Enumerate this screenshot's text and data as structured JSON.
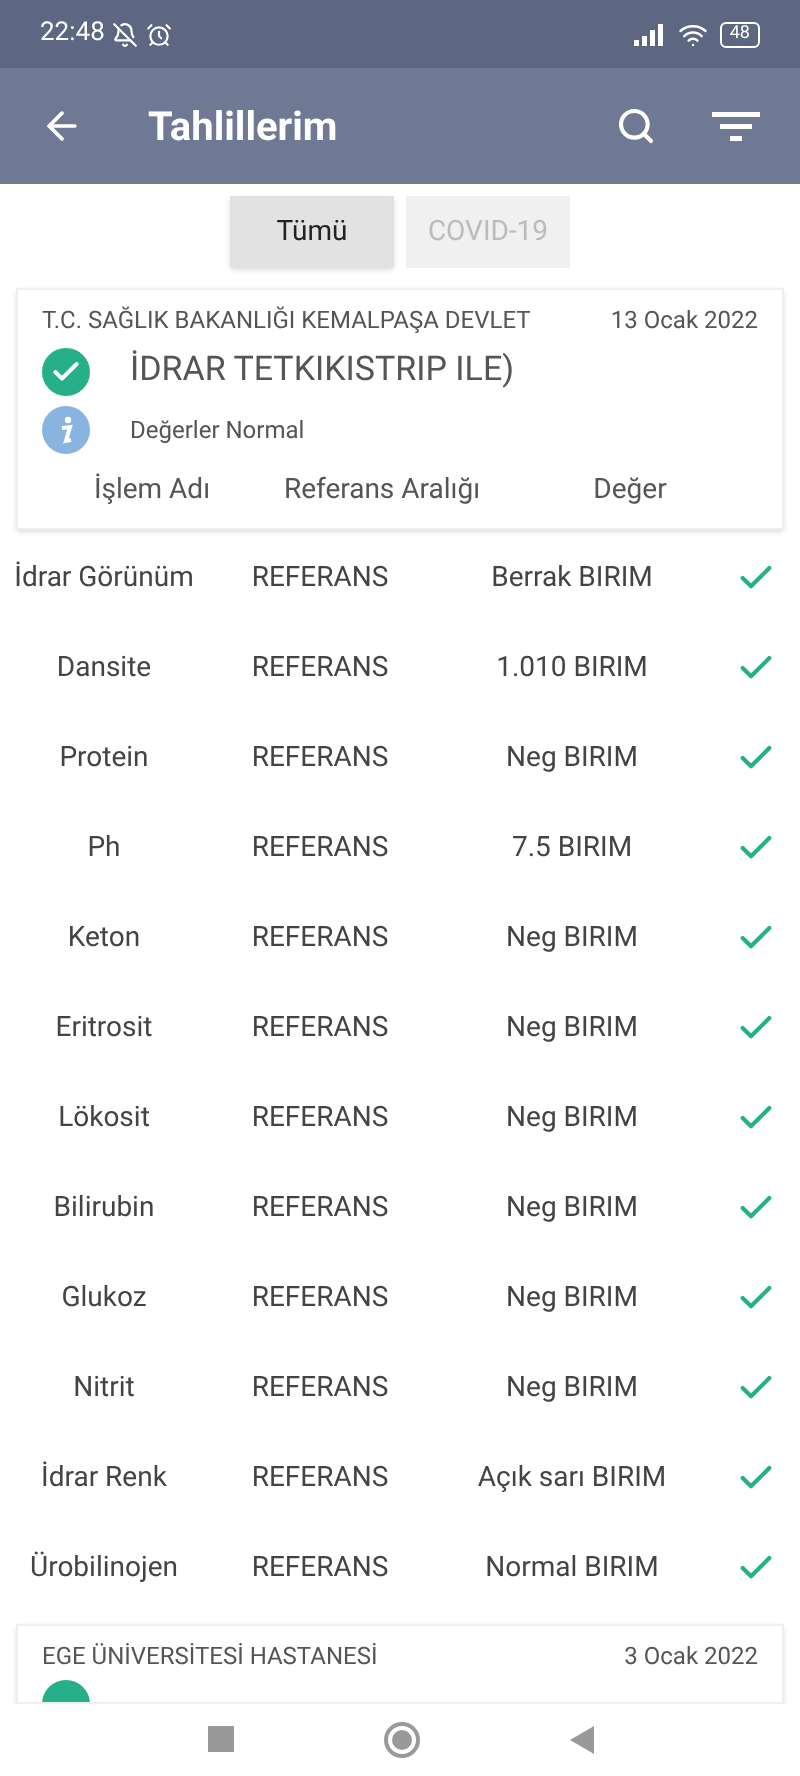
{
  "status_bar": {
    "time": "22:48",
    "battery": "48"
  },
  "app_bar": {
    "title": "Tahlillerim"
  },
  "tabs": [
    {
      "label": "Tümü",
      "selected": true
    },
    {
      "label": "COVID-19",
      "selected": false
    }
  ],
  "cards": [
    {
      "institution": "T.C. SAĞLIK BAKANLIĞI KEMALPAŞA DEVLET",
      "date": "13 Ocak 2022",
      "title": "İDRAR TETKIKISTRIP ILE)",
      "note": "Değerler Normal",
      "columns": [
        "İşlem Adı",
        "Referans Aralığı",
        "Değer"
      ],
      "rows": [
        {
          "name": "İdrar Görünüm",
          "reference": "REFERANS",
          "value": "Berrak BIRIM",
          "normal": true
        },
        {
          "name": "Dansite",
          "reference": "REFERANS",
          "value": "1.010 BIRIM",
          "normal": true
        },
        {
          "name": "Protein",
          "reference": "REFERANS",
          "value": "Neg BIRIM",
          "normal": true
        },
        {
          "name": "Ph",
          "reference": "REFERANS",
          "value": "7.5 BIRIM",
          "normal": true
        },
        {
          "name": "Keton",
          "reference": "REFERANS",
          "value": "Neg BIRIM",
          "normal": true
        },
        {
          "name": "Eritrosit",
          "reference": "REFERANS",
          "value": "Neg BIRIM",
          "normal": true
        },
        {
          "name": "Lökosit",
          "reference": "REFERANS",
          "value": "Neg BIRIM",
          "normal": true
        },
        {
          "name": "Bilirubin",
          "reference": "REFERANS",
          "value": "Neg BIRIM",
          "normal": true
        },
        {
          "name": "Glukoz",
          "reference": "REFERANS",
          "value": "Neg BIRIM",
          "normal": true
        },
        {
          "name": "Nitrit",
          "reference": "REFERANS",
          "value": "Neg BIRIM",
          "normal": true
        },
        {
          "name": "İdrar Renk",
          "reference": "REFERANS",
          "value": "Açık sarı BIRIM",
          "normal": true
        },
        {
          "name": "Ürobilinojen",
          "reference": "REFERANS",
          "value": "Normal BIRIM",
          "normal": true
        }
      ]
    },
    {
      "institution": "EGE ÜNİVERSİTESİ HASTANESİ",
      "date": "3 Ocak 2022"
    }
  ]
}
